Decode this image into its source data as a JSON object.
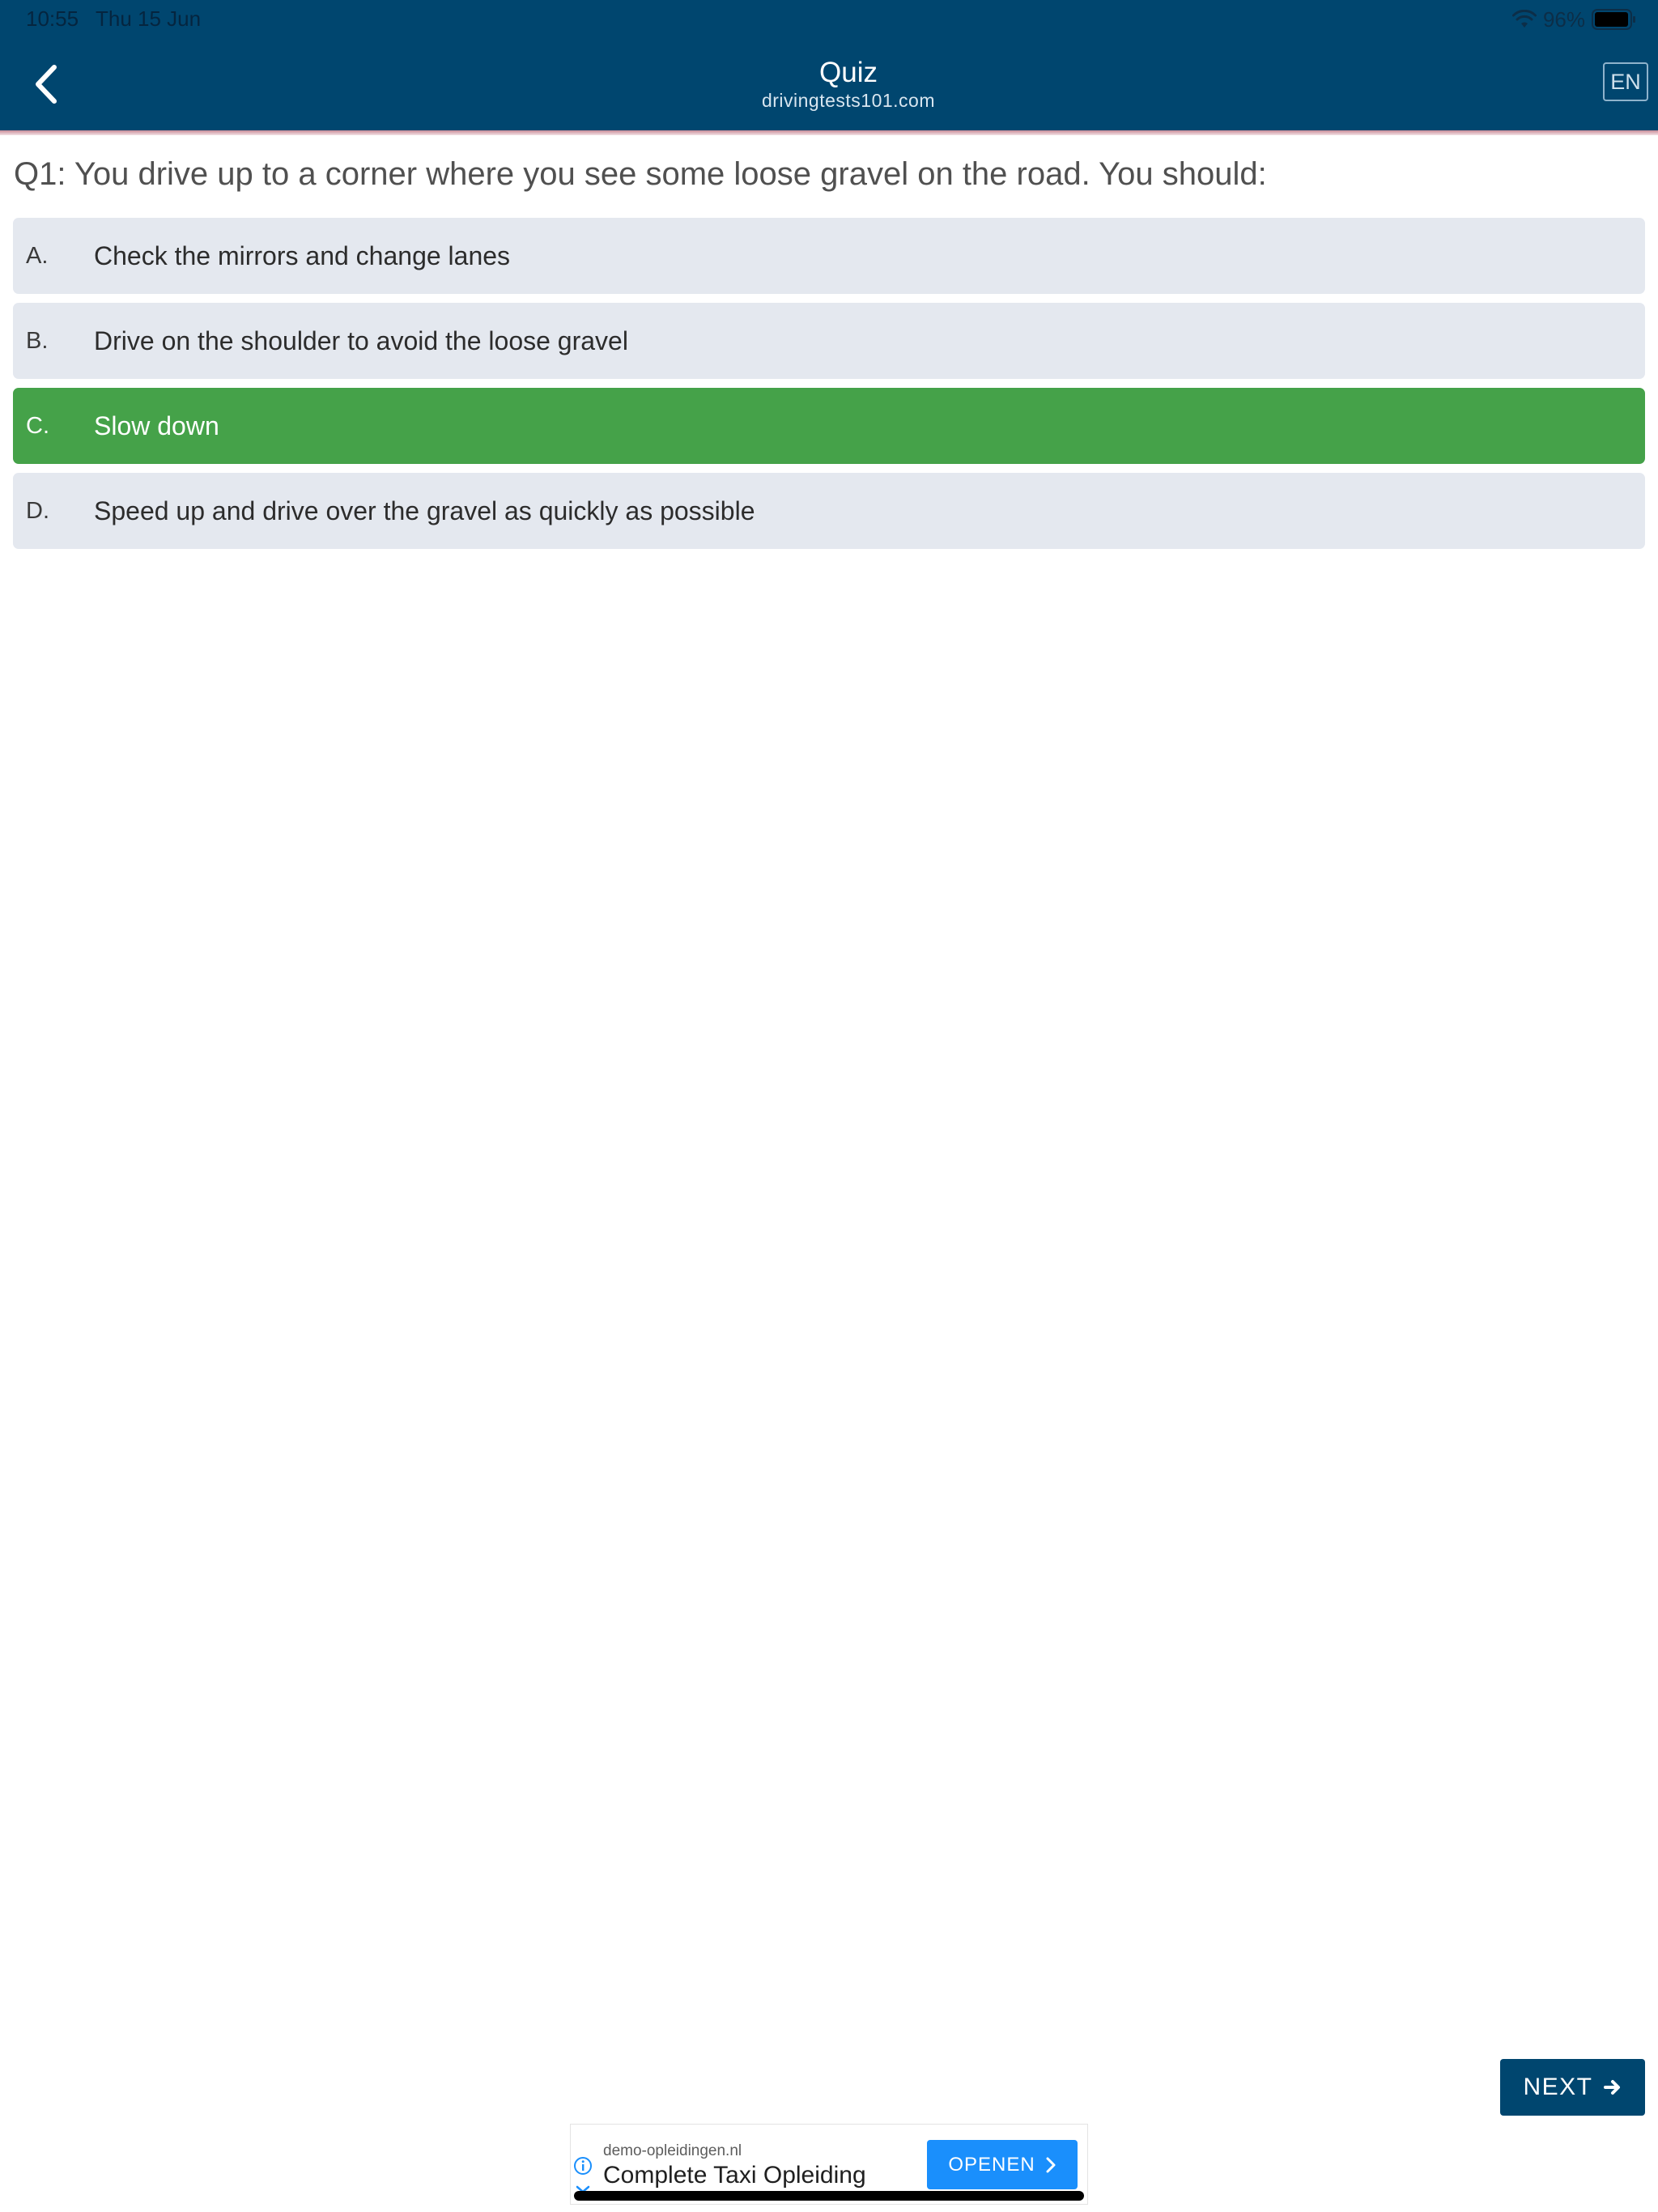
{
  "status_bar": {
    "time": "10:55",
    "date": "Thu 15 Jun",
    "battery": "96%"
  },
  "header": {
    "title": "Quiz",
    "subtitle": "drivingtests101.com",
    "language": "EN",
    "background_color": "#00466f"
  },
  "question": {
    "text": "Q1: You drive up to a corner where you see some loose gravel on the road. You should:"
  },
  "answers": [
    {
      "letter": "A.",
      "text": "Check the mirrors and change lanes",
      "state": "default"
    },
    {
      "letter": "B.",
      "text": "Drive on the shoulder to avoid the loose gravel",
      "state": "default"
    },
    {
      "letter": "C.",
      "text": "Slow down",
      "state": "correct"
    },
    {
      "letter": "D.",
      "text": "Speed up and drive over the gravel as quickly as possible",
      "state": "default"
    }
  ],
  "colors": {
    "answer_default": "#e4e8ef",
    "answer_correct": "#45a249"
  },
  "next_button": {
    "label": "NEXT"
  },
  "ad": {
    "domain": "demo-opleidingen.nl",
    "title": "Complete Taxi Opleiding",
    "cta": "OPENEN",
    "cta_color": "#1a8ffc"
  },
  "icons": {
    "back": "chevron-left-icon",
    "wifi": "wifi-icon",
    "battery": "battery-icon",
    "next": "arrow-right-icon",
    "ad_info": "info-icon",
    "ad_close": "close-icon",
    "ad_cta": "chevron-right-icon"
  }
}
